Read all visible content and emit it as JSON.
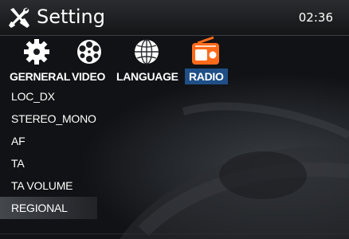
{
  "header": {
    "title": "Setting",
    "title_icon": "wrench-screwdriver-icon",
    "clock": "02:36"
  },
  "tabs": [
    {
      "label": "GERNERAL",
      "icon": "gear-icon",
      "active": false
    },
    {
      "label": "VIDEO",
      "icon": "film-reel-icon",
      "active": false
    },
    {
      "label": "LANGUAGE",
      "icon": "globe-icon",
      "active": false
    },
    {
      "label": "RADIO",
      "icon": "radio-icon",
      "active": true
    }
  ],
  "menu": {
    "items": [
      {
        "label": "LOC_DX"
      },
      {
        "label": "STEREO_MONO"
      },
      {
        "label": "AF"
      },
      {
        "label": "TA"
      },
      {
        "label": "TA VOLUME"
      },
      {
        "label": "REGIONAL",
        "selected": true
      }
    ]
  },
  "colors": {
    "active_tab": "#1f4f86",
    "radio_icon": "#ff6a1a",
    "text": "#ffffff"
  }
}
